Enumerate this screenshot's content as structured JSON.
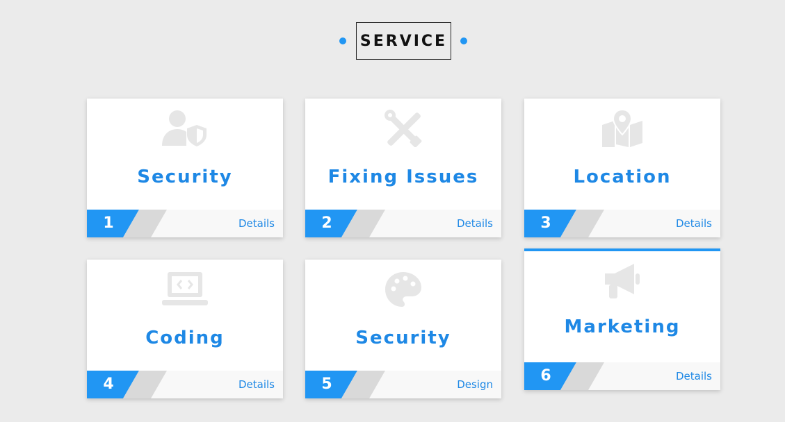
{
  "header": {
    "title": "SERVICE"
  },
  "colors": {
    "accent": "#2196f3",
    "title_text": "#1e88e5",
    "icon": "#e6e6e6",
    "stripe_gray": "#d9d9d9",
    "background": "#ebebeb"
  },
  "cards": [
    {
      "title": "Security",
      "number": "1",
      "link": "Details",
      "icon": "user-shield-icon"
    },
    {
      "title": "Fixing Issues",
      "number": "2",
      "link": "Details",
      "icon": "tools-icon"
    },
    {
      "title": "Location",
      "number": "3",
      "link": "Details",
      "icon": "map-marker-icon"
    },
    {
      "title": "Coding",
      "number": "4",
      "link": "Details",
      "icon": "laptop-code-icon"
    },
    {
      "title": "Security",
      "number": "5",
      "link": "Design",
      "icon": "palette-icon"
    },
    {
      "title": "Marketing",
      "number": "6",
      "link": "Details",
      "icon": "megaphone-icon"
    }
  ]
}
